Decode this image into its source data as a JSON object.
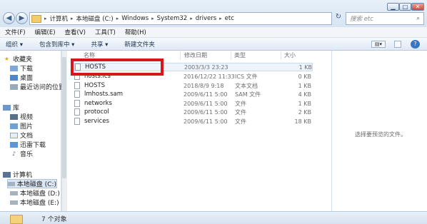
{
  "titlebar": {
    "breadcrumbs": [
      "计算机",
      "本地磁盘 (C:)",
      "Windows",
      "System32",
      "drivers",
      "etc"
    ],
    "search_placeholder": "搜索 etc",
    "back_glyph": "◀",
    "forward_glyph": "▶",
    "min_glyph": "▁",
    "max_glyph": "□",
    "close_glyph": "✕",
    "refresh_glyph": "↻",
    "search_glyph": "⌕"
  },
  "menubar": [
    "文件(F)",
    "编辑(E)",
    "查看(V)",
    "工具(T)",
    "帮助(H)"
  ],
  "commandbar": {
    "organize": "组织 ▾",
    "include": "包含到库中 ▾",
    "share": "共享 ▾",
    "new_folder": "新建文件夹"
  },
  "navpane": {
    "favorites": "收藏夹",
    "fav_items": [
      "下载",
      "桌面",
      "最近访问的位置"
    ],
    "libraries": "库",
    "lib_items": [
      "视频",
      "图片",
      "文档",
      "迅雷下载",
      "音乐"
    ],
    "computer": "计算机",
    "drives": [
      "本地磁盘 (C:)",
      "本地磁盘 (D:)",
      "本地磁盘 (E:)"
    ]
  },
  "filelist": {
    "columns": [
      "名称",
      "修改日期",
      "类型",
      "大小"
    ],
    "rows": [
      {
        "name": "HOSTS",
        "date": "2003/3/3 23:23",
        "type": "",
        "size": "1 KB"
      },
      {
        "name": "hosts.ics",
        "date": "2016/12/22 11:33",
        "type": "ICS 文件",
        "size": "0 KB"
      },
      {
        "name": "HOSTS",
        "date": "2018/8/9 9:18",
        "type": "文本文档",
        "size": "1 KB"
      },
      {
        "name": "lmhosts.sam",
        "date": "2009/6/11 5:00",
        "type": "SAM 文件",
        "size": "4 KB"
      },
      {
        "name": "networks",
        "date": "2009/6/11 5:00",
        "type": "文件",
        "size": "1 KB"
      },
      {
        "name": "protocol",
        "date": "2009/6/11 5:00",
        "type": "文件",
        "size": "2 KB"
      },
      {
        "name": "services",
        "date": "2009/6/11 5:00",
        "type": "文件",
        "size": "18 KB"
      }
    ]
  },
  "preview": {
    "text": "选择要预览的文件。"
  },
  "status": {
    "text": "7 个对象"
  },
  "colors": {
    "highlight_box": "#d9141b",
    "selection": "#dce7f5"
  }
}
